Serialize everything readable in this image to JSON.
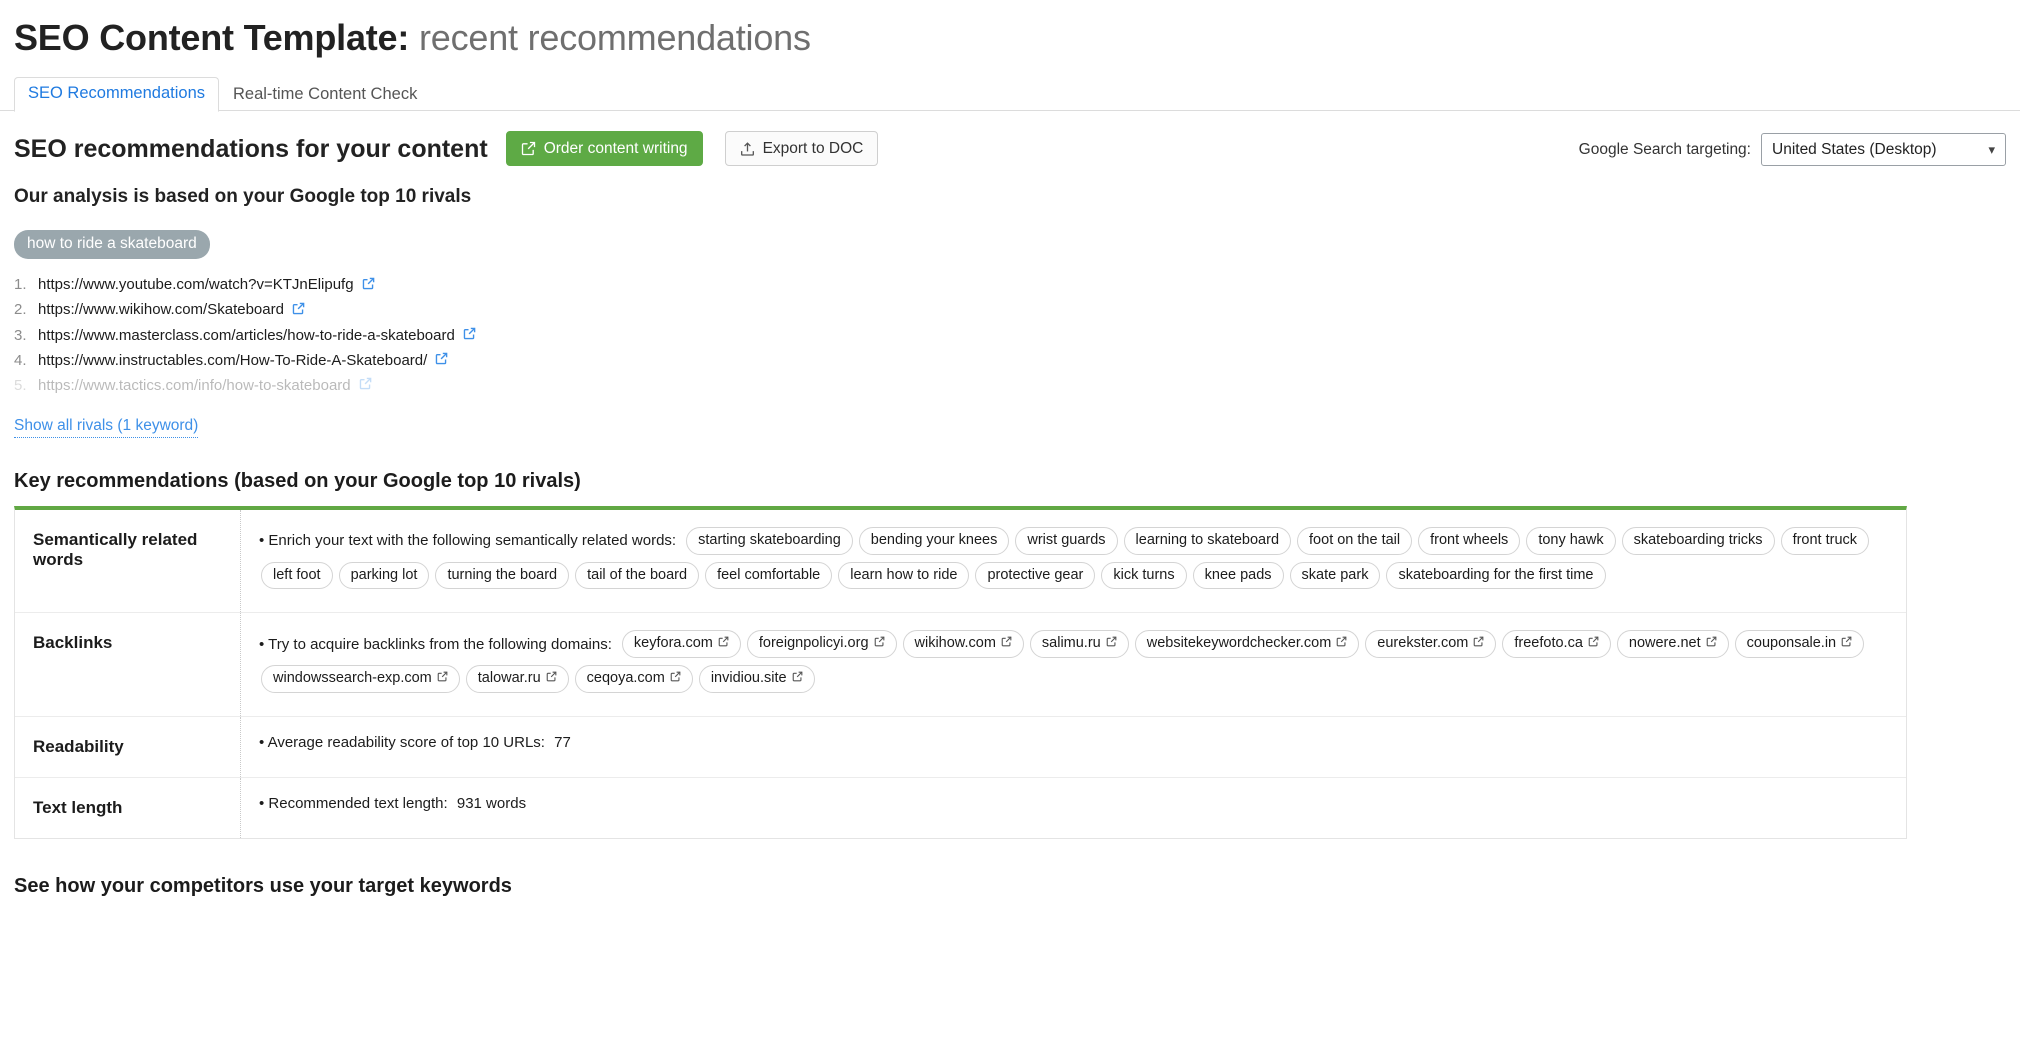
{
  "header": {
    "title_main": "SEO Content Template:",
    "title_sub": "recent recommendations"
  },
  "tabs": [
    {
      "label": "SEO Recommendations",
      "active": true
    },
    {
      "label": "Real-time Content Check",
      "active": false
    }
  ],
  "toolbar": {
    "section_title": "SEO recommendations for your content",
    "order_button": "Order content writing",
    "export_button": "Export to DOC",
    "targeting_label": "Google Search targeting:",
    "targeting_value": "United States (Desktop)",
    "accent_green": "#5eaa45",
    "accent_blue": "#3e90e8"
  },
  "analysis": {
    "subhead": "Our analysis is based on your Google top 10 rivals",
    "keyword": "how to ride a skateboard",
    "rivals": [
      {
        "url": "https://www.youtube.com/watch?v=KTJnElipufg",
        "faded": false
      },
      {
        "url": "https://www.wikihow.com/Skateboard",
        "faded": false
      },
      {
        "url": "https://www.masterclass.com/articles/how-to-ride-a-skateboard",
        "faded": false
      },
      {
        "url": "https://www.instructables.com/How-To-Ride-A-Skateboard/",
        "faded": false
      },
      {
        "url": "https://www.tactics.com/info/how-to-skateboard",
        "faded": true
      }
    ],
    "show_all_link": "Show all rivals (1 keyword)"
  },
  "key_recommendations": {
    "title": "Key recommendations (based on your Google top 10 rivals)",
    "rows": [
      {
        "label": "Semantically related words",
        "prefix": "• Enrich your text with the following semantically related words:",
        "chips": [
          "starting skateboarding",
          "bending your knees",
          "wrist guards",
          "learning to skateboard",
          "foot on the tail",
          "front wheels",
          "tony hawk",
          "skateboarding tricks",
          "front truck",
          "left foot",
          "parking lot",
          "turning the board",
          "tail of the board",
          "feel comfortable",
          "learn how to ride",
          "protective gear",
          "kick turns",
          "knee pads",
          "skate park",
          "skateboarding for the first time"
        ]
      },
      {
        "label": "Backlinks",
        "prefix": "• Try to acquire backlinks from the following domains:",
        "chips": [
          "keyfora.com",
          "foreignpolicyi.org",
          "wikihow.com",
          "salimu.ru",
          "websitekeywordchecker.com",
          "eurekster.com",
          "freefoto.ca",
          "nowere.net",
          "couponsale.in",
          "windowssearch-exp.com",
          "talowar.ru",
          "ceqoya.com",
          "invidiou.site"
        ]
      },
      {
        "label": "Readability",
        "plain_text": "• Average readability score of top 10 URLs:",
        "plain_value": "77"
      },
      {
        "label": "Text length",
        "plain_text": "• Recommended text length:",
        "plain_value": "931 words"
      }
    ]
  },
  "footer": {
    "title": "See how your competitors use your target keywords"
  },
  "icons": {
    "order": "pencil-square-icon",
    "export": "upload-icon",
    "external": "external-link-icon",
    "chevron": "chevron-down-icon"
  }
}
